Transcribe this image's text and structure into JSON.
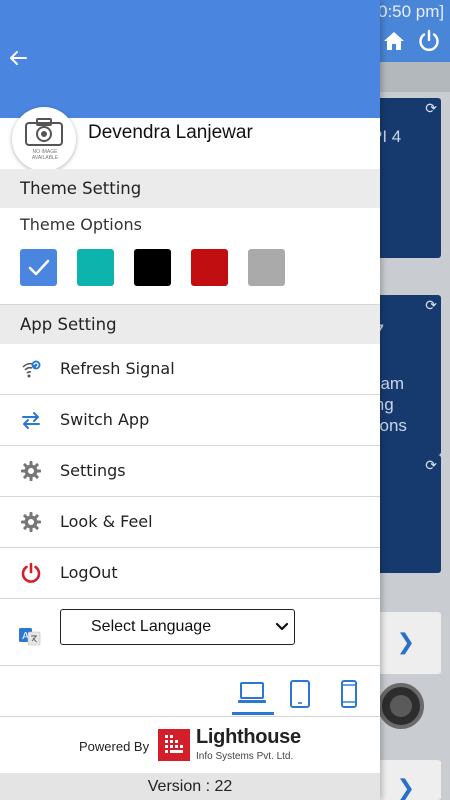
{
  "background": {
    "time": "0:50 pm]",
    "cards": [
      {
        "lines": [
          "PI 4"
        ]
      },
      {
        "lines": [
          "7",
          "",
          "eam",
          "ing",
          "tions"
        ]
      },
      {
        "lines": []
      }
    ]
  },
  "drawer": {
    "user": {
      "name": "Devendra Lanjewar",
      "avatar_placeholder": "NO IMAGE AVAILABLE"
    },
    "theme": {
      "section_title": "Theme Setting",
      "options_label": "Theme Options",
      "swatches": [
        "#4a86e0",
        "#0cb4ad",
        "#000000",
        "#c10e11",
        "#aaaaaa"
      ],
      "selected_index": 0
    },
    "app_settings": {
      "section_title": "App Setting",
      "items": [
        {
          "label": "Refresh Signal",
          "icon": "refresh-signal-icon"
        },
        {
          "label": "Switch App",
          "icon": "switch-arrows-icon"
        },
        {
          "label": "Settings",
          "icon": "gear-icon"
        },
        {
          "label": "Look & Feel",
          "icon": "gear-icon"
        },
        {
          "label": "LogOut",
          "icon": "power-icon"
        }
      ]
    },
    "language": {
      "selected": "Select Language"
    },
    "device_modes": [
      "laptop",
      "tablet",
      "phone"
    ],
    "selected_device_mode": "laptop",
    "footer": {
      "powered_by": "Powered By",
      "company": "Lighthouse",
      "company_sub": "Info Systems Pvt. Ltd.",
      "version": "Version : 22"
    }
  },
  "colors": {
    "header_blue": "#4a86e0",
    "accent_blue": "#2b78d4",
    "logout_red": "#d41f2a"
  }
}
